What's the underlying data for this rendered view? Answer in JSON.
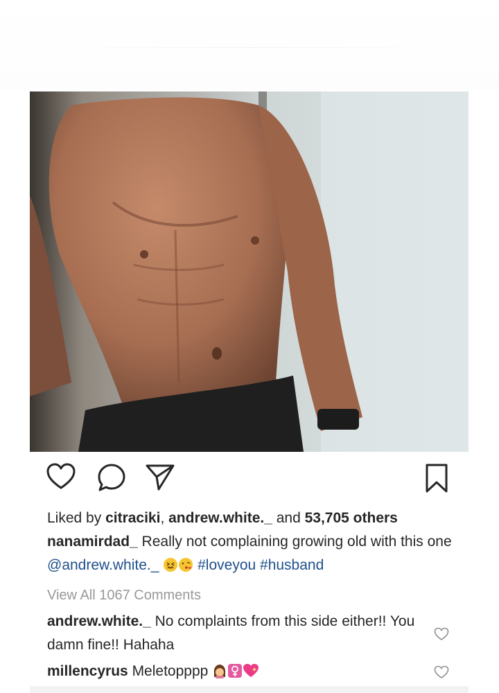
{
  "post": {
    "image_alt": "shirtless torso photo",
    "likes": {
      "prefix": "Liked by ",
      "user1": "citraciki",
      "sep": ", ",
      "user2": "andrew.white._",
      "mid": " and ",
      "others": "53,705 others"
    },
    "caption": {
      "author": "nanamirdad_",
      "text": " Really not complaining growing old with this one ",
      "mention": "@andrew.white._",
      "tag1": "#loveyou",
      "tag2": "#husband"
    },
    "view_all": "View All 1067 Comments"
  },
  "comments": [
    {
      "user": "andrew.white._",
      "text": " No complaints from this side either!! You damn fine!! Hahaha"
    },
    {
      "user": "millencyrus",
      "text": " Meletopppp"
    }
  ],
  "icons": {
    "like": "heart-icon",
    "comment": "comment-icon",
    "share": "send-icon",
    "save": "bookmark-icon",
    "comment_like": "small-heart-icon"
  },
  "colors": {
    "text": "#262626",
    "link": "#1f4f8c",
    "muted": "#999999"
  }
}
